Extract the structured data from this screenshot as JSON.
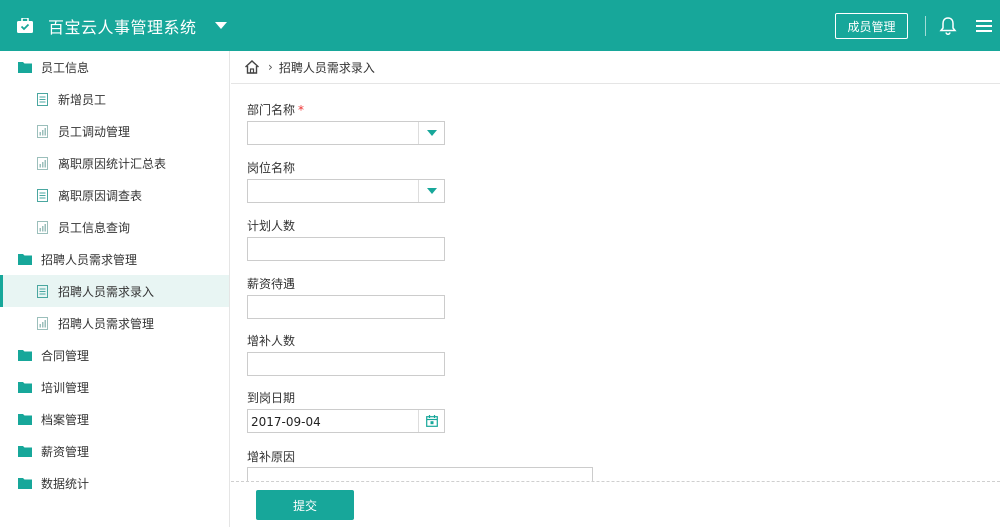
{
  "header": {
    "app_title": "百宝云人事管理系统",
    "member_button": "成员管理",
    "icons": [
      "briefcase-icon",
      "chevron-down-icon",
      "bell-icon",
      "menu-icon"
    ],
    "accent_color": "#17a79a"
  },
  "sidebar": {
    "items": [
      {
        "label": "员工信息",
        "type": "group",
        "icon": "folder-icon"
      },
      {
        "label": "新增员工",
        "type": "sub",
        "icon": "document-icon"
      },
      {
        "label": "员工调动管理",
        "type": "sub",
        "icon": "report-icon"
      },
      {
        "label": "离职原因统计汇总表",
        "type": "sub",
        "icon": "report-icon"
      },
      {
        "label": "离职原因调查表",
        "type": "sub",
        "icon": "document-icon"
      },
      {
        "label": "员工信息查询",
        "type": "sub",
        "icon": "report-icon"
      },
      {
        "label": "招聘人员需求管理",
        "type": "group",
        "icon": "folder-icon"
      },
      {
        "label": "招聘人员需求录入",
        "type": "sub",
        "icon": "document-icon",
        "active": true
      },
      {
        "label": "招聘人员需求管理",
        "type": "sub",
        "icon": "report-icon"
      },
      {
        "label": "合同管理",
        "type": "group",
        "icon": "folder-icon"
      },
      {
        "label": "培训管理",
        "type": "group",
        "icon": "folder-icon"
      },
      {
        "label": "档案管理",
        "type": "group",
        "icon": "folder-icon"
      },
      {
        "label": "薪资管理",
        "type": "group",
        "icon": "folder-icon"
      },
      {
        "label": "数据统计",
        "type": "group",
        "icon": "folder-icon"
      }
    ]
  },
  "breadcrumb": {
    "separator": "›",
    "current": "招聘人员需求录入"
  },
  "form": {
    "department_label": "部门名称",
    "required_mark": "*",
    "position_label": "岗位名称",
    "planned_count_label": "计划人数",
    "salary_label": "薪资待遇",
    "supplement_count_label": "增补人数",
    "arrival_date_label": "到岗日期",
    "arrival_date_value": "2017-09-04",
    "supplement_reason_label": "增补原因",
    "submit_label": "提交"
  }
}
